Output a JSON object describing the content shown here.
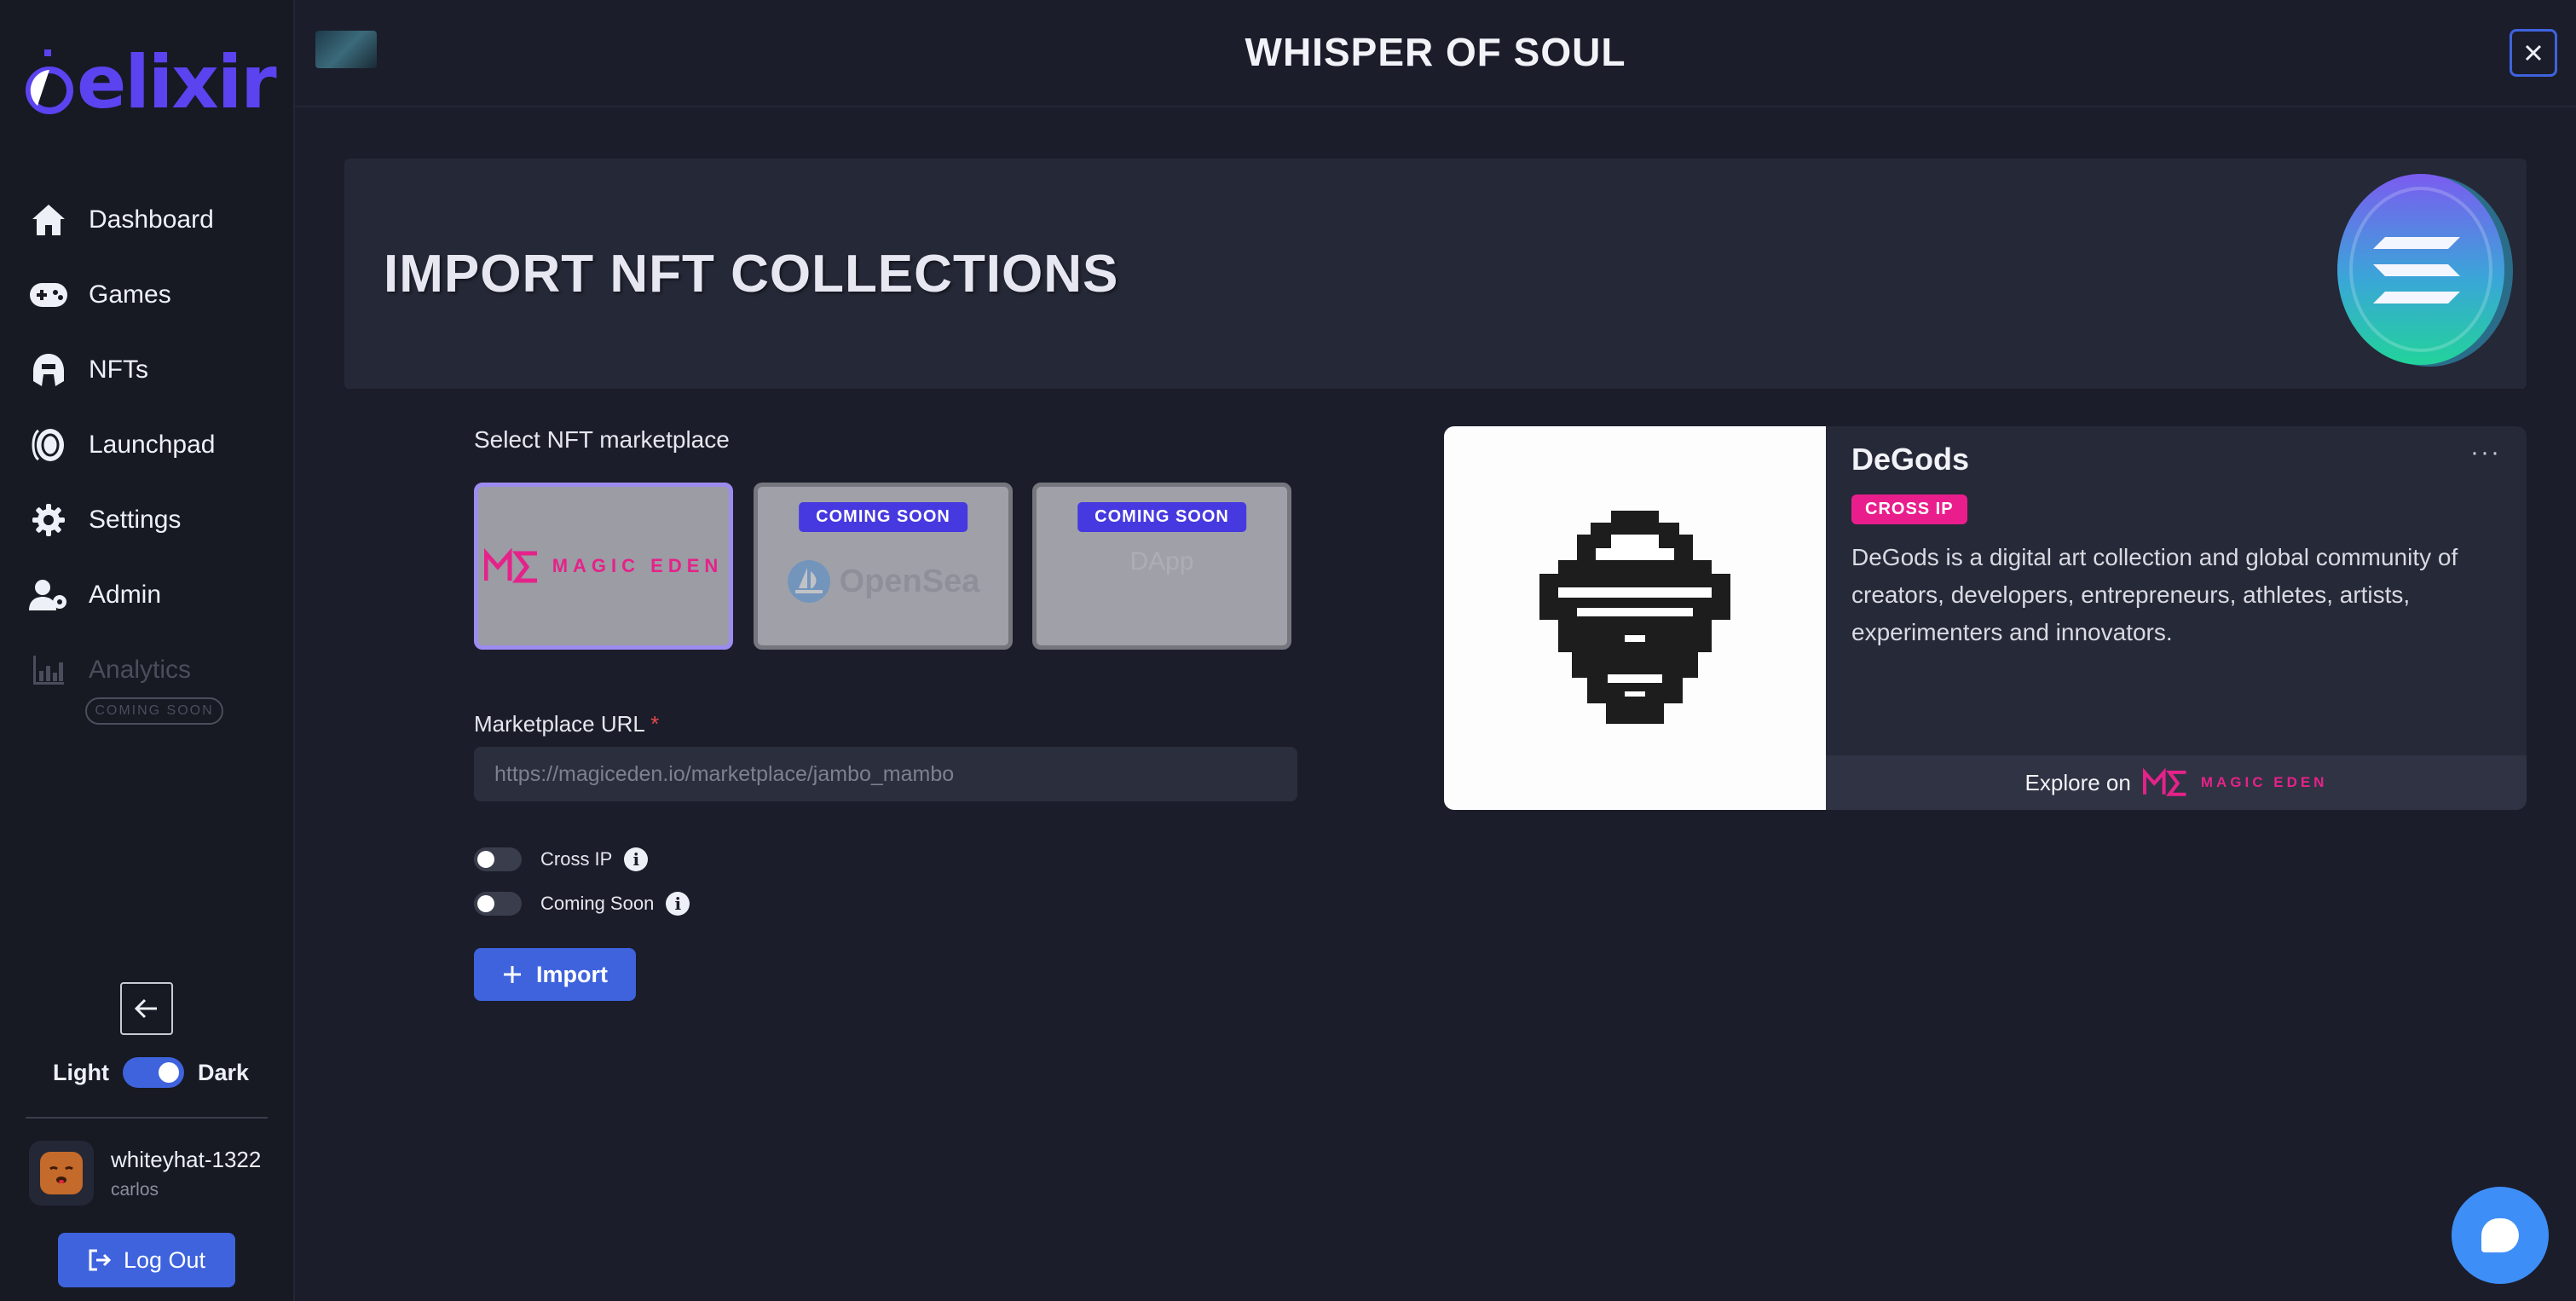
{
  "brand": {
    "name": "elixir"
  },
  "sidebar": {
    "items": [
      {
        "label": "Dashboard",
        "icon": "home-icon"
      },
      {
        "label": "Games",
        "icon": "gamepad-icon"
      },
      {
        "label": "NFTs",
        "icon": "helmet-icon"
      },
      {
        "label": "Launchpad",
        "icon": "coin-icon"
      },
      {
        "label": "Settings",
        "icon": "gear-icon"
      },
      {
        "label": "Admin",
        "icon": "user-admin-icon"
      },
      {
        "label": "Analytics",
        "icon": "chart-icon",
        "badge": "COMING SOON",
        "disabled": true
      }
    ],
    "theme": {
      "light_label": "Light",
      "dark_label": "Dark",
      "dark_enabled": true
    },
    "user": {
      "username": "whiteyhat-1322",
      "name": "carlos"
    },
    "logout_label": "Log Out"
  },
  "header": {
    "title": "WHISPER OF SOUL"
  },
  "hero": {
    "title": "IMPORT NFT COLLECTIONS"
  },
  "form": {
    "marketplace_label": "Select NFT marketplace",
    "marketplaces": [
      {
        "name": "MAGIC EDEN",
        "selected": true
      },
      {
        "name": "OpenSea",
        "badge": "COMING SOON"
      },
      {
        "name": "DApp",
        "badge": "COMING SOON"
      }
    ],
    "url_label": "Marketplace URL",
    "required_mark": "*",
    "url_placeholder": "https://magiceden.io/marketplace/jambo_mambo",
    "toggles": [
      {
        "label": "Cross IP",
        "on": false
      },
      {
        "label": "Coming Soon",
        "on": false
      }
    ],
    "import_label": "Import"
  },
  "preview": {
    "name": "DeGods",
    "tag": "CROSS IP",
    "description": "DeGods is a digital art collection and global community of creators, developers, entrepreneurs, athletes, artists, experimenters and innovators.",
    "explore_label": "Explore on",
    "explore_brand": "MAGIC EDEN"
  },
  "colors": {
    "accent": "#3e63dd",
    "brand": "#5b43f0",
    "magic_eden": "#e5228a",
    "cross_ip": "#e91e8c"
  }
}
